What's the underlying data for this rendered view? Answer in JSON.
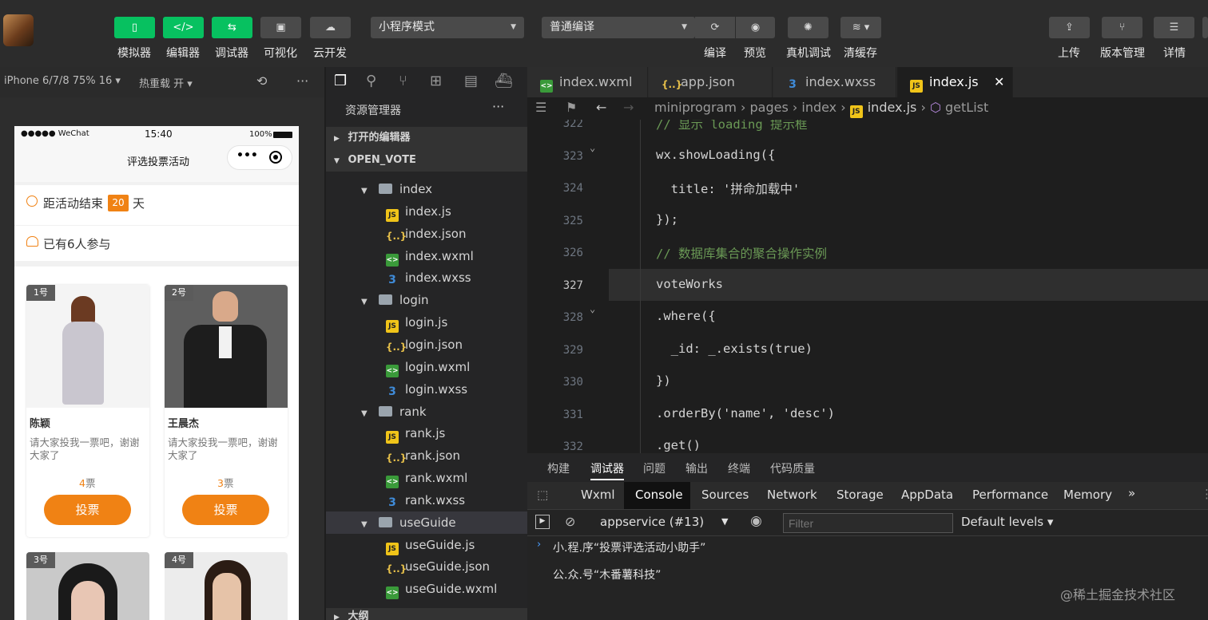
{
  "toolbar": {
    "simulator": "模拟器",
    "editor": "编辑器",
    "debugger": "调试器",
    "visual": "可视化",
    "cloud": "云开发",
    "mode": "小程序模式",
    "compile_mode": "普通编译",
    "compile": "编译",
    "preview": "预览",
    "remote_debug": "真机调试",
    "clear_cache": "清缓存",
    "upload": "上传",
    "version": "版本管理",
    "details": "详情"
  },
  "sim": {
    "device": "iPhone 6/7/8 75% 16",
    "hotreload": "热重载 开",
    "status_left": "●●●●● WeChat",
    "status_time": "15:40",
    "status_battery": "100%",
    "nav_title": "评选投票活动",
    "countdown_label": "距活动结束",
    "countdown_days": "20",
    "countdown_unit": "天",
    "participants": "已有6人参与",
    "cards": [
      {
        "badge": "1号",
        "name": "陈颖",
        "desc": "请大家投我一票吧，谢谢大家了",
        "votes_num": "4",
        "votes_unit": "票",
        "button": "投票"
      },
      {
        "badge": "2号",
        "name": "王晨杰",
        "desc": "请大家投我一票吧，谢谢大家了",
        "votes_num": "3",
        "votes_unit": "票",
        "button": "投票"
      },
      {
        "badge": "3号"
      },
      {
        "badge": "4号"
      }
    ]
  },
  "explorer": {
    "title": "资源管理器",
    "open_editors": "打开的编辑器",
    "project": "OPEN_VOTE",
    "items": [
      {
        "type": "folder",
        "label": "index"
      },
      {
        "type": "js",
        "label": "index.js"
      },
      {
        "type": "json",
        "label": "index.json"
      },
      {
        "type": "wxml",
        "label": "index.wxml"
      },
      {
        "type": "wxss",
        "label": "index.wxss"
      },
      {
        "type": "folder",
        "label": "login"
      },
      {
        "type": "js",
        "label": "login.js"
      },
      {
        "type": "json",
        "label": "login.json"
      },
      {
        "type": "wxml",
        "label": "login.wxml"
      },
      {
        "type": "wxss",
        "label": "login.wxss"
      },
      {
        "type": "folder",
        "label": "rank"
      },
      {
        "type": "js",
        "label": "rank.js"
      },
      {
        "type": "json",
        "label": "rank.json"
      },
      {
        "type": "wxml",
        "label": "rank.wxml"
      },
      {
        "type": "wxss",
        "label": "rank.wxss"
      },
      {
        "type": "folder",
        "label": "useGuide"
      },
      {
        "type": "js",
        "label": "useGuide.js"
      },
      {
        "type": "json",
        "label": "useGuide.json"
      },
      {
        "type": "wxml",
        "label": "useGuide.wxml"
      }
    ],
    "outline": "大纲"
  },
  "tabs": [
    "index.wxml",
    "app.json",
    "index.wxss",
    "index.js"
  ],
  "breadcrumb": [
    "miniprogram",
    "pages",
    "index",
    "index.js",
    "getList"
  ],
  "code": [
    {
      "n": "322",
      "text": "// 显示 loading 提示框"
    },
    {
      "n": "323",
      "text": "wx.showLoading({"
    },
    {
      "n": "324",
      "text": "  title: '拼命加载中'"
    },
    {
      "n": "325",
      "text": "});"
    },
    {
      "n": "326",
      "text": "// 数据库集合的聚合操作实例"
    },
    {
      "n": "327",
      "text": "voteWorks"
    },
    {
      "n": "328",
      "text": ".where({"
    },
    {
      "n": "329",
      "text": "  _id: _.exists(true)"
    },
    {
      "n": "330",
      "text": "})"
    },
    {
      "n": "331",
      "text": ".orderBy('name', 'desc')"
    },
    {
      "n": "332",
      "text": ".get()"
    }
  ],
  "panel_tabs": [
    "构建",
    "调试器",
    "问题",
    "输出",
    "终端",
    "代码质量"
  ],
  "console_tabs": [
    "Wxml",
    "Console",
    "Sources",
    "Network",
    "Storage",
    "AppData",
    "Performance",
    "Memory"
  ],
  "console": {
    "context": "appservice (#13)",
    "filter_placeholder": "Filter",
    "levels": "Default levels",
    "lines": [
      "小.程.序“投票评选活动小助手”",
      "公.众.号“木番薯科技”"
    ],
    "watermark": "@稀土掘金技术社区"
  }
}
